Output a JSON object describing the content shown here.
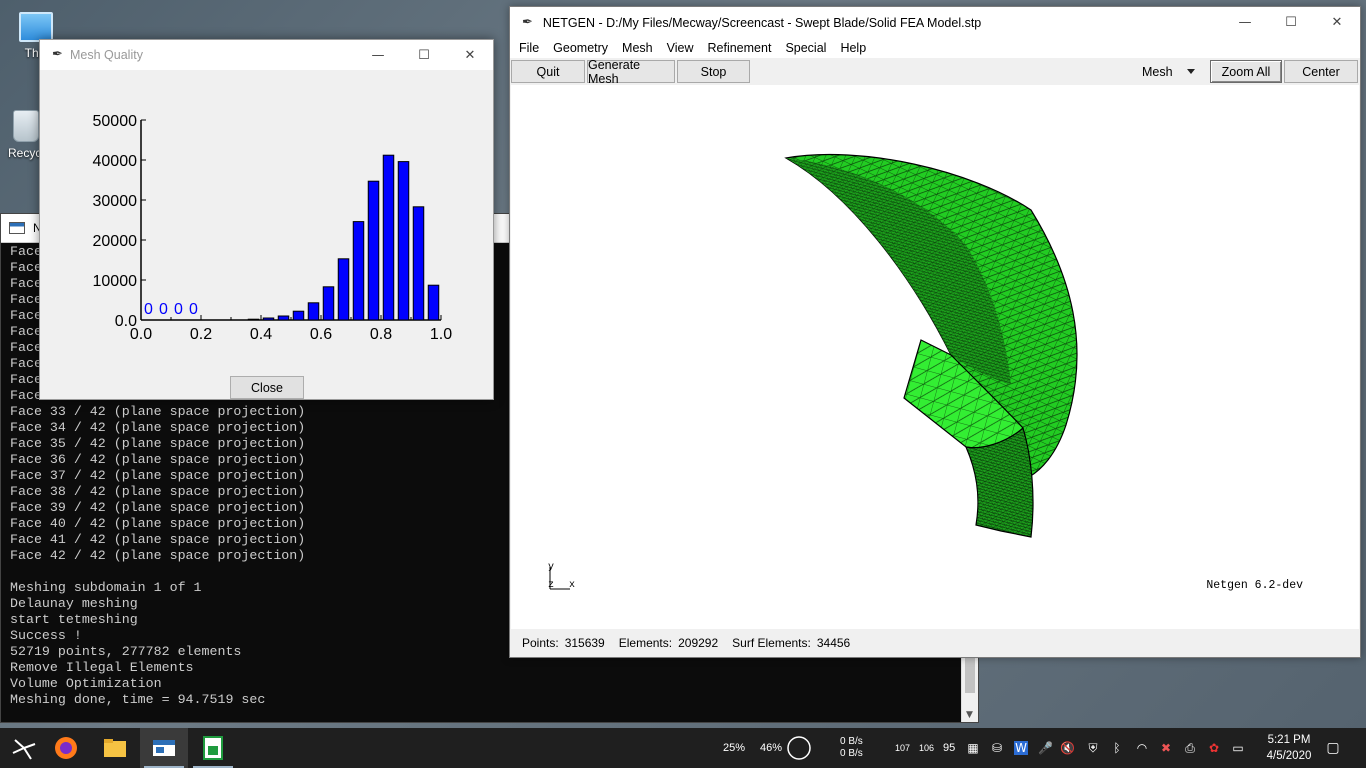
{
  "desktop": {
    "icons": [
      {
        "label": "This"
      },
      {
        "label": "Recycl"
      }
    ]
  },
  "console": {
    "title": "N",
    "lines": [
      "Face",
      "Face",
      "Face",
      "Face",
      "Face",
      "Face",
      "Face",
      "Face",
      "Face",
      "Face",
      "Face 33 / 42 (plane space projection)",
      "Face 34 / 42 (plane space projection)",
      "Face 35 / 42 (plane space projection)",
      "Face 36 / 42 (plane space projection)",
      "Face 37 / 42 (plane space projection)",
      "Face 38 / 42 (plane space projection)",
      "Face 39 / 42 (plane space projection)",
      "Face 40 / 42 (plane space projection)",
      "Face 41 / 42 (plane space projection)",
      "Face 42 / 42 (plane space projection)",
      "",
      "Meshing subdomain 1 of 1",
      "Delaunay meshing",
      "start tetmeshing",
      "Success !",
      "52719 points, 277782 elements",
      "Remove Illegal Elements",
      "Volume Optimization",
      "Meshing done, time = 94.7519 sec"
    ]
  },
  "mesh_quality": {
    "title": "Mesh Quality",
    "close_label": "Close",
    "chart_data": {
      "type": "bar",
      "x": [
        0.025,
        0.075,
        0.125,
        0.175,
        0.225,
        0.275,
        0.325,
        0.375,
        0.425,
        0.475,
        0.525,
        0.575,
        0.625,
        0.675,
        0.725,
        0.775,
        0.825,
        0.875,
        0.925,
        0.975
      ],
      "values": [
        0,
        0,
        0,
        0,
        0,
        0,
        0,
        200,
        500,
        1000,
        2200,
        4300,
        8300,
        15300,
        24600,
        34700,
        41200,
        39600,
        28300,
        8700
      ],
      "zero_labels": [
        "0",
        "0",
        "0",
        "0"
      ],
      "xlim": [
        0.0,
        1.0
      ],
      "ylim": [
        0,
        50000
      ],
      "xticks": [
        "0.0",
        "0.2",
        "0.4",
        "0.6",
        "0.8",
        "1.0"
      ],
      "yticks": [
        "0.0",
        "10000",
        "20000",
        "30000",
        "40000",
        "50000"
      ],
      "bar_color": "#0000ff",
      "label_color": "#0000ff"
    }
  },
  "netgen": {
    "title": "NETGEN - D:/My Files/Mecway/Screencast - Swept Blade/Solid FEA Model.stp",
    "menu": [
      "File",
      "Geometry",
      "Mesh",
      "View",
      "Refinement",
      "Special",
      "Help"
    ],
    "toolbar": {
      "quit": "Quit",
      "generate_mesh": "Generate Mesh",
      "stop": "Stop",
      "view_mode": "Mesh",
      "zoom_all": "Zoom All",
      "center": "Center"
    },
    "axes": {
      "y": "y",
      "z": "z",
      "x": "x"
    },
    "version": "Netgen 6.2-dev",
    "mesh_color": "#22cc22",
    "status": {
      "points_label": "Points:",
      "points_value": "315639",
      "elements_label": "Elements:",
      "elements_value": "209292",
      "surf_label": "Surf Elements:",
      "surf_value": "34456"
    }
  },
  "taskbar": {
    "cpu": "25%",
    "mem": "46%",
    "net_up": "0 B/s",
    "net_down": "0 B/s",
    "n1": "107",
    "n2": "106",
    "n3": "95",
    "time": "5:21 PM",
    "date": "4/5/2020"
  }
}
